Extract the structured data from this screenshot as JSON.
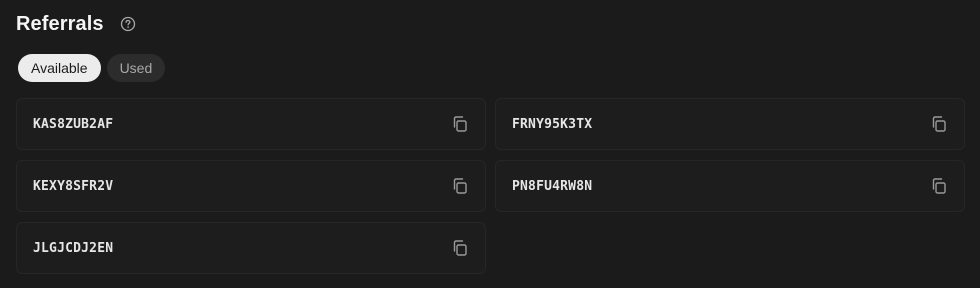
{
  "header": {
    "title": "Referrals",
    "help_icon": "question-circle-icon"
  },
  "tabs": [
    {
      "label": "Available",
      "active": true
    },
    {
      "label": "Used",
      "active": false
    }
  ],
  "referral_codes": [
    {
      "code": "KAS8ZUB2AF",
      "action_icon": "copy-icon"
    },
    {
      "code": "FRNY95K3TX",
      "action_icon": "copy-icon"
    },
    {
      "code": "KEXY8SFR2V",
      "action_icon": "copy-icon"
    },
    {
      "code": "PN8FU4RW8N",
      "action_icon": "copy-icon"
    },
    {
      "code": "JLGJCDJ2EN",
      "action_icon": "copy-icon"
    }
  ],
  "colors": {
    "background": "#1b1b1b",
    "card_background": "#1d1d1d",
    "active_tab": "#ececec",
    "inactive_tab": "#2c2c2c"
  }
}
